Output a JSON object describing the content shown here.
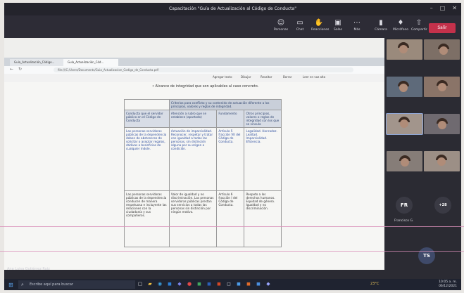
{
  "window": {
    "title": "Capacitación \"Guía de Actualización al Código de Conducta\""
  },
  "toolbar": {
    "timer": "",
    "tools": [
      {
        "icon": "people-icon",
        "label": "Personas"
      },
      {
        "icon": "chat-icon",
        "label": "Chat"
      },
      {
        "icon": "reactions-icon",
        "label": "Reacciones"
      },
      {
        "icon": "rooms-icon",
        "label": "Salas"
      },
      {
        "icon": "more-icon",
        "label": "Más"
      },
      {
        "icon": "camera-icon",
        "label": "Cámara"
      },
      {
        "icon": "mic-icon",
        "label": "Micrófono"
      },
      {
        "icon": "share-icon",
        "label": "Compartir"
      }
    ],
    "leave_label": "Salir"
  },
  "browser": {
    "tabs": [
      "Guía_Actualización_Código...",
      "Guía_Actualización_Cód..."
    ],
    "url": "file:///C:/Users/Documents/Guia_Actualizacion_Codigo_de_Conducta.pdf",
    "pdf_tools": [
      "Agregar texto",
      "Dibujar",
      "Resaltar",
      "Borrar",
      "Leer en voz alta"
    ]
  },
  "document": {
    "intro": "• Alcance de integridad que son aplicables al caso concreto.",
    "table": {
      "header": "Criterios para conflicto y su contenido de actuación diferente a los principios, valores y reglas de integridad.",
      "col1_title": "Conducta que el servidor público en el Código de Conducta",
      "col2_title": "Atención a rubro que se establece (apartado)",
      "col3_title": "Fundamento",
      "col4_title": "Otros principios, valores o reglas de integridad con los que se vincula",
      "row1": {
        "c1": "Las personas servidoras públicas de la dependencia deben de abstenerse de solicitar o aceptar regalos, dádivas o beneficios de cualquier índole.",
        "c2": "Actuación de imparcialidad. Reconocer, respetar y tratar con igualdad a todas las personas, sin distinción alguna por su origen o condición.",
        "c3": "Artículo 5 fracción VII del Código de Conducta.",
        "c4": "Legalidad. Honradez. Lealtad. Imparcialidad. Eficiencia."
      },
      "row2": {
        "c1": "Las personas servidoras públicas de la dependencia conducen de manera respetuosa e incluyente las relaciones con la ciudadanía y sus compañeros.",
        "c2": "Valor de igualdad y no discriminación. Las personas servidoras públicas prestan sus servicios a todas las personas sin distinción por ningún motivo.",
        "c3": "Artículo 6 fracción I del Código de Conducta.",
        "c4": "Respeto a los derechos humanos. Equidad de género. Igualdad y no discriminación."
      }
    }
  },
  "presenter": {
    "name": "Ana Luisa Gutiérrez Ruiz"
  },
  "gallery": {
    "participants": [
      {
        "initials": "FR",
        "name": "Francisco G."
      },
      {
        "initials": "+28",
        "name": ""
      },
      {
        "initials": "TS",
        "name": ""
      }
    ]
  },
  "taskbar": {
    "search_placeholder": "Escribe aquí para buscar",
    "weather": "23°C",
    "time": "10:05 a. m.",
    "date": "06/12/2021"
  }
}
